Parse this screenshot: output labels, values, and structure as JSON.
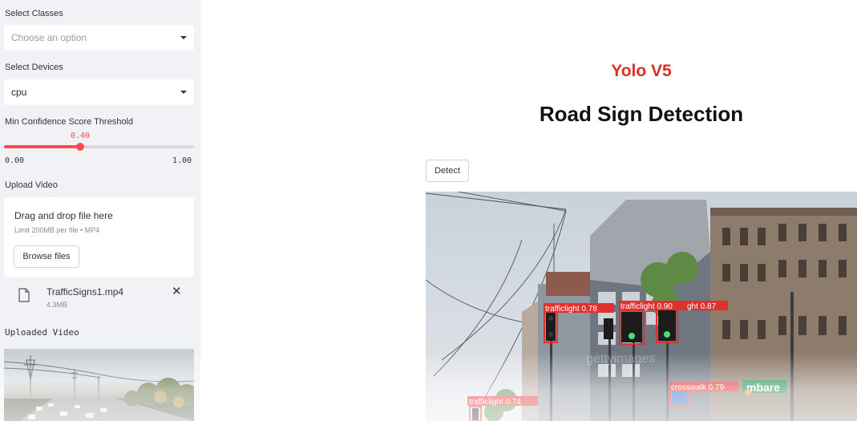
{
  "sidebar": {
    "classes": {
      "label": "Select Classes",
      "placeholder": "Choose an option"
    },
    "devices": {
      "label": "Select Devices",
      "value": "cpu"
    },
    "confidence": {
      "label": "Min Confidence Score Threshold",
      "value": "0.40",
      "min": "0.00",
      "max": "1.00",
      "fraction": 0.4
    },
    "upload": {
      "label": "Upload Video",
      "drop_title": "Drag and drop file here",
      "drop_limit": "Limit 200MB per file • MP4",
      "browse_label": "Browse files",
      "file_name": "TrafficSigns1.mp4",
      "file_size": "4.3MB",
      "remove_glyph": "✕"
    },
    "uploaded_label": "Uploaded Video"
  },
  "main": {
    "subtitle": "Yolo V5",
    "title": "Road Sign Detection",
    "detect_label": "Detect"
  },
  "detections": [
    {
      "label": "trafficlight 0.78"
    },
    {
      "label": "trafficlight 0.90"
    },
    {
      "label": "ght 0.87"
    },
    {
      "label": "crosswalk 0.79"
    },
    {
      "label": "trafficlight 0.74"
    }
  ],
  "scene_text": {
    "watermark": "gettyimages",
    "shop_sign": "mbare"
  },
  "colors": {
    "accent": "#ff4b4b",
    "subtitle": "#d93025",
    "sidebar_bg": "#f0f2f6",
    "detection_box": "#e0312f"
  },
  "icons": {
    "file": "file-icon",
    "remove": "close-icon",
    "select_arrow": "caret-down-icon"
  }
}
